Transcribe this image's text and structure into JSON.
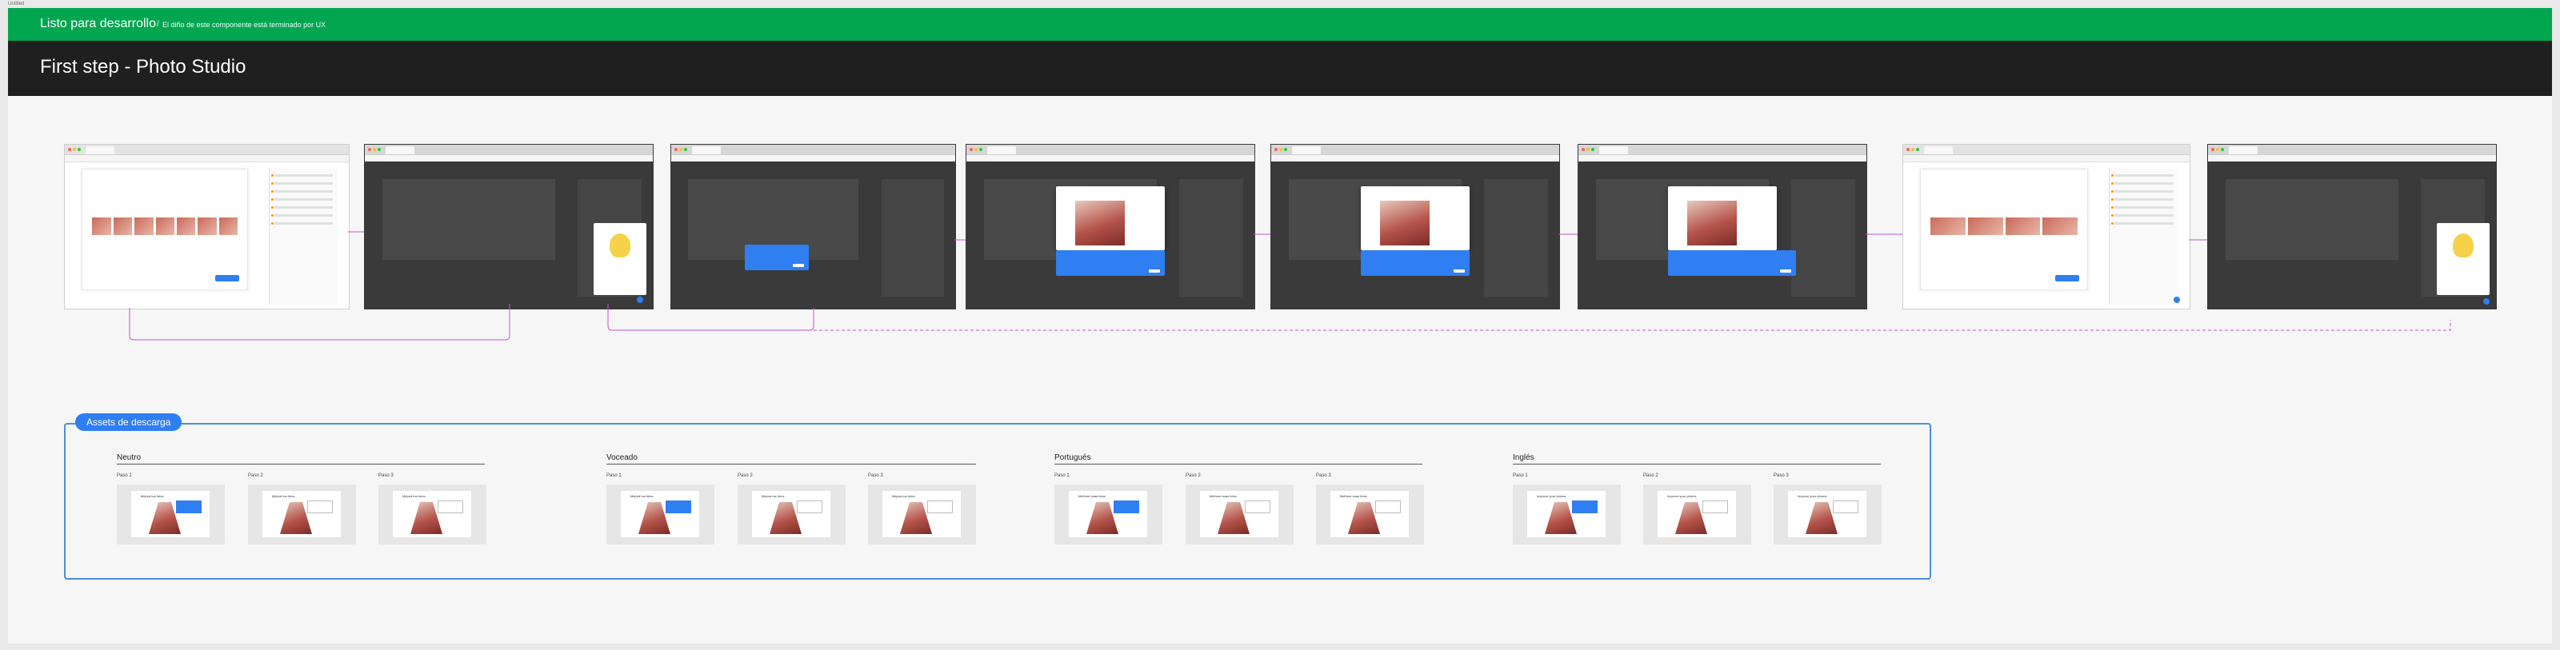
{
  "canvas_label": "Untitled",
  "status_bar": {
    "title": "Listo para desarrollo",
    "separator": "/",
    "subtitle": "El diño de este componente está terminado por UX",
    "color": "#02a650"
  },
  "page_title": "First step - Photo Studio",
  "flow_screens": [
    {
      "theme": "light"
    },
    {
      "theme": "dark"
    },
    {
      "theme": "dark"
    },
    {
      "theme": "dark"
    },
    {
      "theme": "dark"
    },
    {
      "theme": "dark"
    },
    {
      "theme": "light"
    },
    {
      "theme": "dark"
    }
  ],
  "assets": {
    "label": "Assets de descarga",
    "groups": [
      {
        "title": "Neutro",
        "steps": [
          {
            "label": "Paso 1",
            "card_title": "Mejorá tus fotos"
          },
          {
            "label": "Paso 2",
            "card_title": "Mejorá tus fotos"
          },
          {
            "label": "Paso 3",
            "card_title": "Mejorá tus fotos"
          }
        ]
      },
      {
        "title": "Voceado",
        "steps": [
          {
            "label": "Paso 1",
            "card_title": "Mejorá tus fotos"
          },
          {
            "label": "Paso 2",
            "card_title": "Mejorá tus fotos"
          },
          {
            "label": "Paso 3",
            "card_title": "Mejorá tus fotos"
          }
        ]
      },
      {
        "title": "Portugués",
        "steps": [
          {
            "label": "Paso 1",
            "card_title": "Melhore suas fotos"
          },
          {
            "label": "Paso 2",
            "card_title": "Melhore suas fotos"
          },
          {
            "label": "Paso 3",
            "card_title": "Melhore suas fotos"
          }
        ]
      },
      {
        "title": "Inglés",
        "steps": [
          {
            "label": "Paso 1",
            "card_title": "Improve your photos"
          },
          {
            "label": "Paso 2",
            "card_title": "Improve your photos"
          },
          {
            "label": "Paso 3",
            "card_title": "Improve your photos"
          }
        ]
      }
    ]
  },
  "colors": {
    "accent": "#2f7ef2",
    "connector": "#c552c9",
    "header": "#1f1f1f"
  }
}
